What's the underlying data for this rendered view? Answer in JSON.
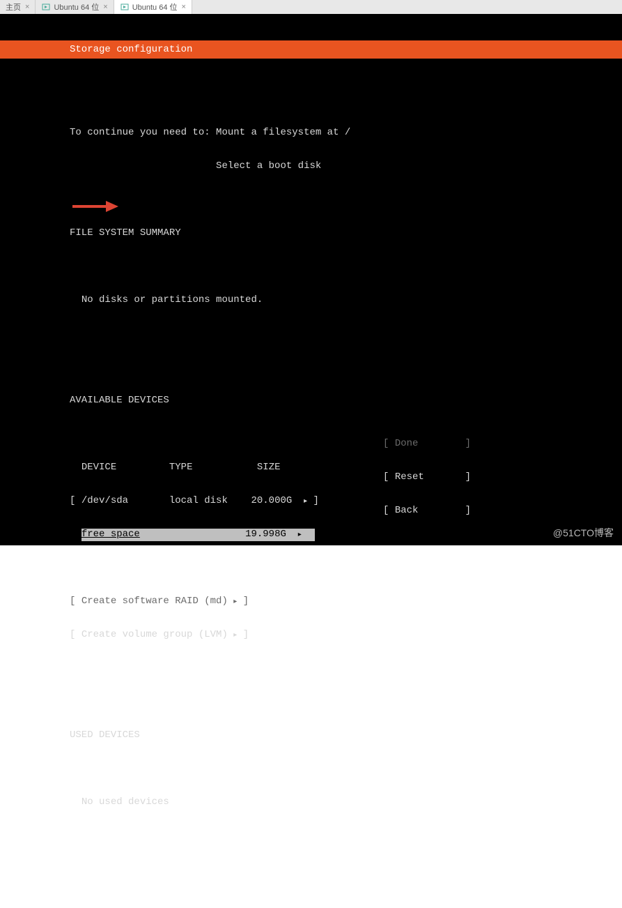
{
  "tabs": {
    "items": [
      {
        "label": "主页",
        "active": false
      },
      {
        "label": "Ubuntu 64 位",
        "active": false
      },
      {
        "label": "Ubuntu 64 位",
        "active": true
      }
    ]
  },
  "header": {
    "title": "Storage configuration"
  },
  "instructions": {
    "prefix": "To continue you need to: ",
    "line1": "Mount a filesystem at /",
    "line2": "Select a boot disk"
  },
  "fs_summary": {
    "heading": "FILE SYSTEM SUMMARY",
    "empty": "No disks or partitions mounted."
  },
  "available": {
    "heading": "AVAILABLE DEVICES",
    "columns": {
      "device": "DEVICE",
      "type": "TYPE",
      "size": "SIZE"
    },
    "rows": [
      {
        "device": "/dev/sda",
        "type": "local disk",
        "size": "20.000G",
        "selected": false
      },
      {
        "device": "free space",
        "type": "",
        "size": "19.998G",
        "selected": true
      }
    ],
    "actions": [
      {
        "label": "Create software RAID (md)",
        "enabled": false
      },
      {
        "label": "Create volume group (LVM)",
        "enabled": true
      }
    ]
  },
  "used": {
    "heading": "USED DEVICES",
    "empty": "No used devices"
  },
  "footer": {
    "done": "Done",
    "reset": "Reset",
    "back": "Back"
  },
  "watermark": "@51CTO博客"
}
